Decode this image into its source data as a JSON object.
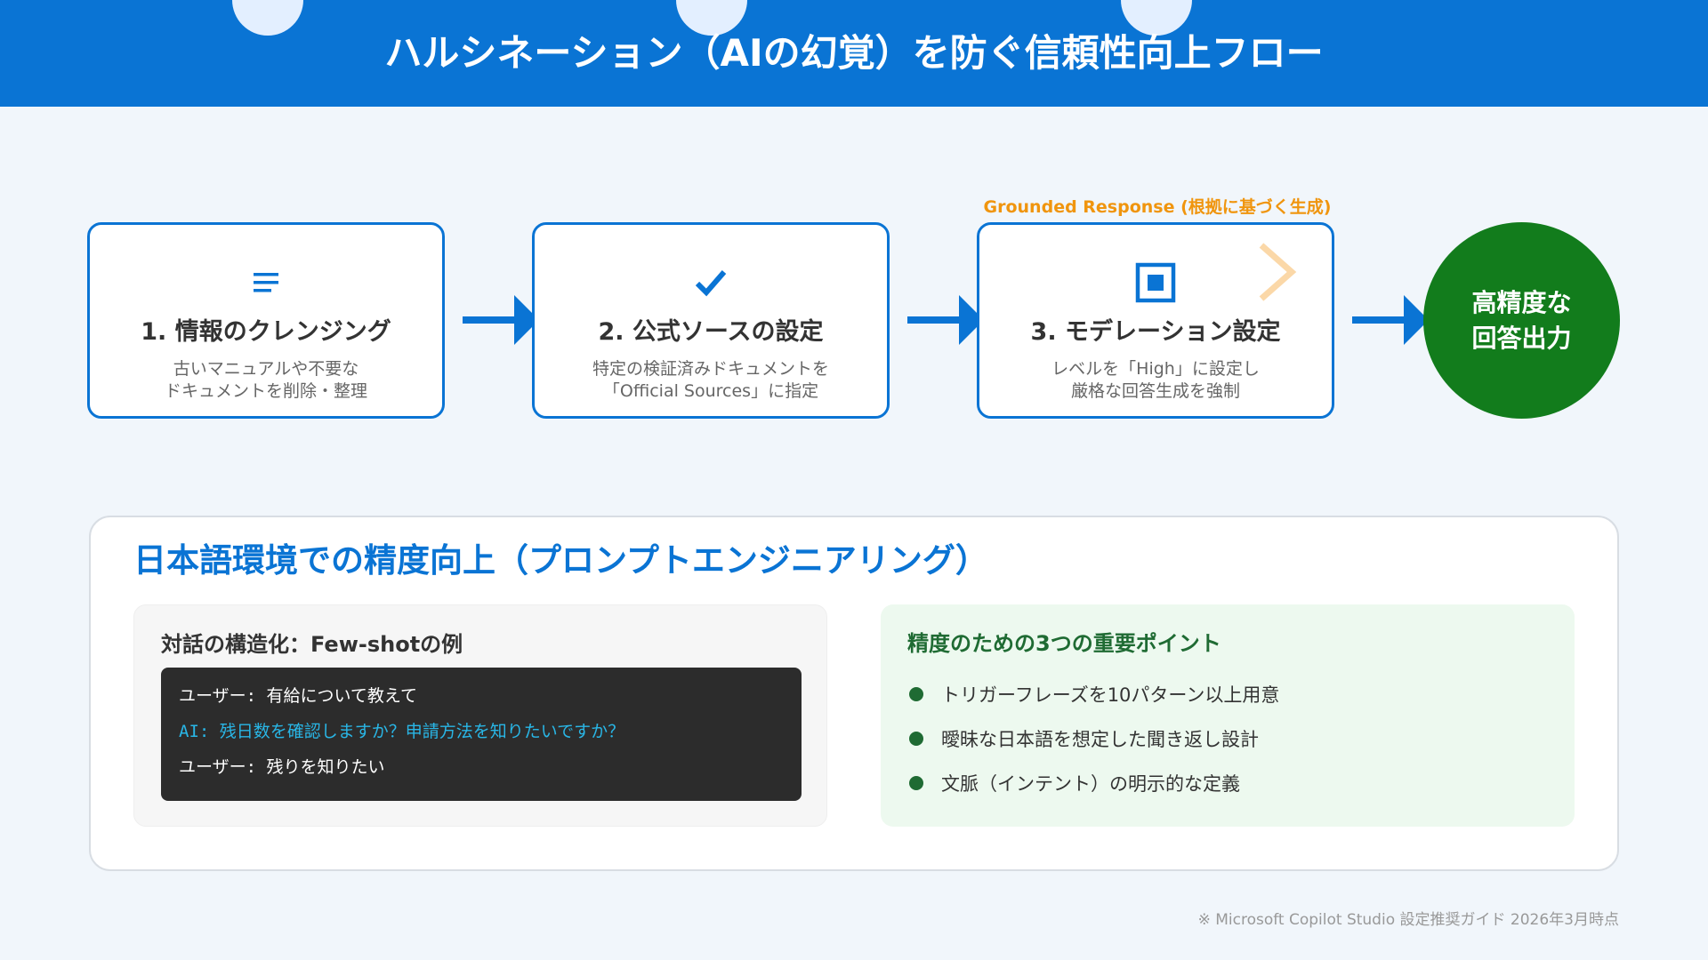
{
  "header": {
    "title": "ハルシネーション（AIの幻覚）を防ぐ信頼性向上フロー"
  },
  "flow": {
    "steps": [
      {
        "icon": "lines-icon",
        "title": "1. 情報のクレンジング",
        "desc_line1": "古いマニュアルや不要な",
        "desc_line2": "ドキュメントを削除・整理"
      },
      {
        "icon": "checkmark-icon",
        "title": "2. 公式ソースの設定",
        "desc_line1": "特定の検証済みドキュメントを",
        "desc_line2": "「Official Sources」に指定"
      },
      {
        "icon": "stop-square-icon",
        "title": "3. モデレーション設定",
        "desc_line1": "レベルを「High」に設定し",
        "desc_line2": "厳格な回答生成を強制"
      }
    ],
    "grounded_label": "Grounded Response (根拠に基づく生成)",
    "result_line1": "高精度な",
    "result_line2": "回答出力"
  },
  "panel": {
    "title": "日本語環境での精度向上（プロンプトエンジニアリング）",
    "left": {
      "title": "対話の構造化：Few-shotの例",
      "lines": [
        "ユーザー: 有給について教えて",
        "AI: 残日数を確認しますか？申請方法を知りたいですか？",
        "ユーザー: 残りを知りたい"
      ]
    },
    "right": {
      "title": "精度のための3つの重要ポイント",
      "points": [
        "トリガーフレーズを10パターン以上用意",
        "曖昧な日本語を想定した聞き返し設計",
        "文脈（インテント）の明示的な定義"
      ]
    }
  },
  "footer": "※ Microsoft Copilot Studio 設定推奨ガイド 2026年3月時点",
  "colors": {
    "primary": "#0a74d4",
    "accent_orange": "#f0950e",
    "result_green": "#127c1c",
    "point_green": "#1f6b33",
    "ai_cyan": "#29b6e6"
  }
}
